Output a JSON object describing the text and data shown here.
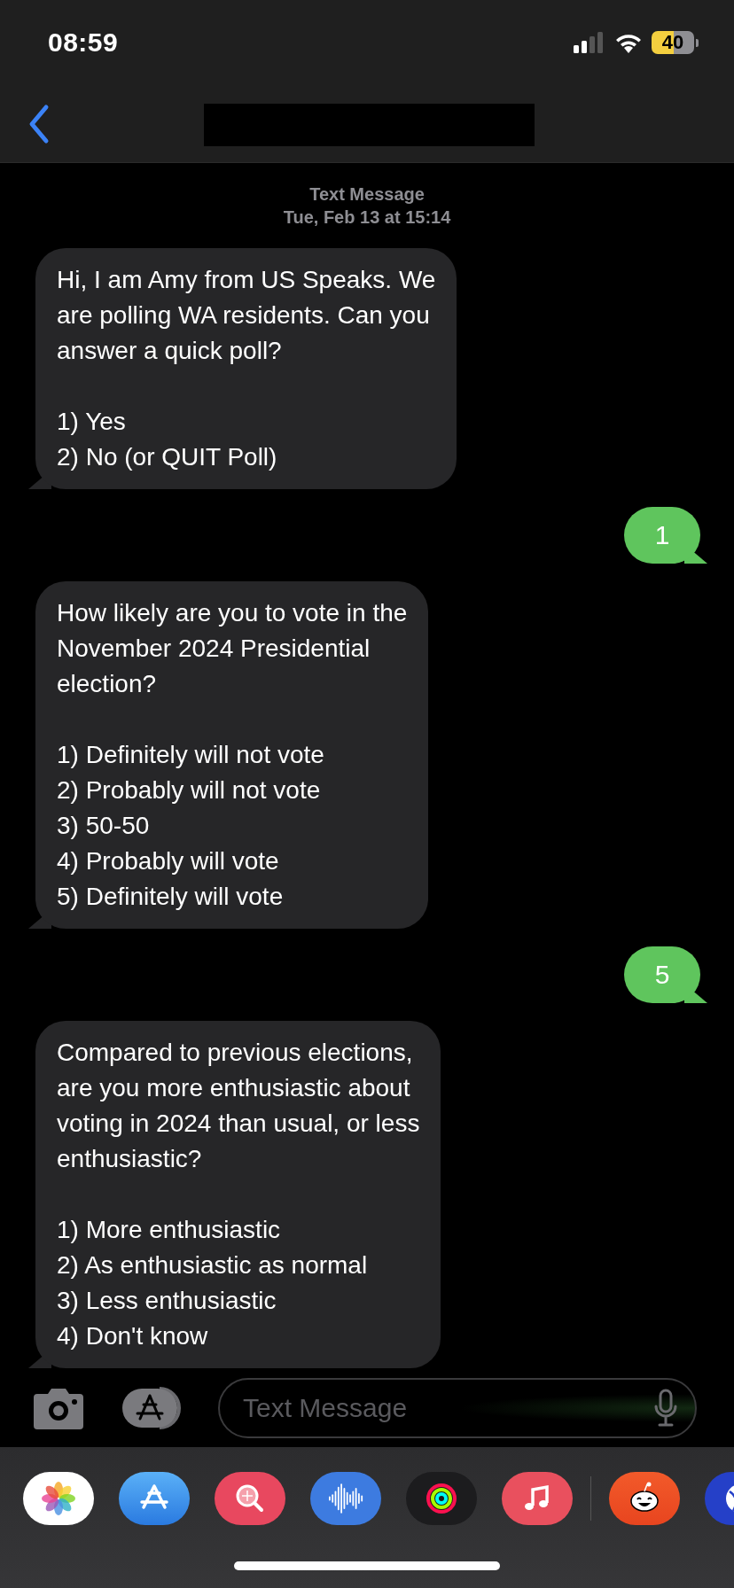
{
  "status_bar": {
    "time": "08:59",
    "battery": "40"
  },
  "thread": {
    "service": "Text Message",
    "date": "Tue, Feb 13 at 15:14"
  },
  "messages": [
    {
      "kind": "received",
      "text": "Hi, I am Amy from US Speaks. We\nare polling WA residents. Can you\nanswer a quick poll?\n\n1) Yes\n2) No (or QUIT Poll)"
    },
    {
      "kind": "sent",
      "text": "1"
    },
    {
      "kind": "received",
      "text": "How likely are you to vote in the\nNovember 2024 Presidential\nelection?\n\n1) Definitely will not vote\n2) Probably will not vote\n3) 50-50\n4) Probably will vote\n5) Definitely will vote"
    },
    {
      "kind": "sent",
      "text": "5"
    },
    {
      "kind": "received",
      "text": "Compared to previous elections,\nare you more enthusiastic about\nvoting in 2024 than usual, or less\nenthusiastic?\n\n1) More enthusiastic\n2) As enthusiastic as normal\n3) Less enthusiastic\n4) Don't know"
    }
  ],
  "composer": {
    "placeholder": "Text Message"
  }
}
